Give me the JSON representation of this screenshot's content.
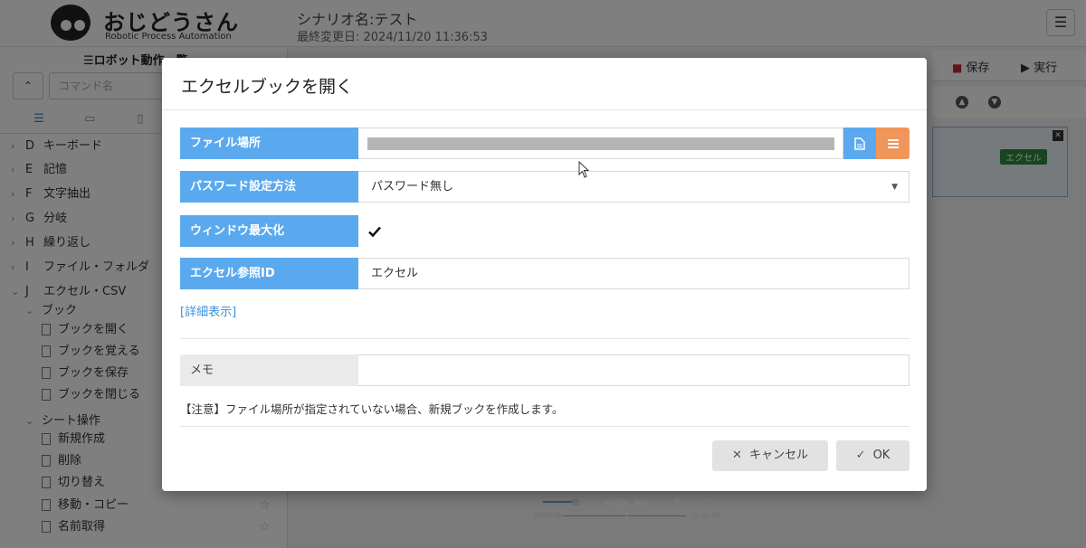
{
  "app": {
    "logo_title": "おじどうさん",
    "logo_subtitle": "Robotic Process Automation",
    "scenario_name": "シナリオ名:テスト",
    "last_modified": "最終変更日: 2024/11/20 11:36:53",
    "menu_icon": "hamburger-icon"
  },
  "left_panel": {
    "title": "☰ロボット動作一覧",
    "search_placeholder": "コマンド名",
    "tree": [
      {
        "letter": "D",
        "label": "キーボード"
      },
      {
        "letter": "E",
        "label": "記憶"
      },
      {
        "letter": "F",
        "label": "文字抽出"
      },
      {
        "letter": "G",
        "label": "分岐"
      },
      {
        "letter": "H",
        "label": "繰り返し"
      },
      {
        "letter": "I",
        "label": "ファイル・フォルダ"
      },
      {
        "letter": "J",
        "label": "エクセル・CSV"
      }
    ],
    "book_group": "ブック",
    "book_items": [
      "ブックを開く",
      "ブックを覚える",
      "ブックを保存",
      "ブックを閉じる"
    ],
    "sheet_group": "シート操作",
    "sheet_items": [
      "新規作成",
      "削除",
      "切り替え",
      "移動・コピー",
      "名前取得"
    ]
  },
  "right_panel": {
    "save_label": "保存",
    "run_label": "実行",
    "card_badge": "エクセル"
  },
  "video": {
    "time_current": "00:32:06",
    "time_total": "01:01:06"
  },
  "modal": {
    "title": "エクセルブックを開く",
    "fields": {
      "file_location": {
        "label": "ファイル場所",
        "value": ""
      },
      "password_method": {
        "label": "パスワード設定方法",
        "value": "パスワード無し"
      },
      "maximize_window": {
        "label": "ウィンドウ最大化",
        "checked": true
      },
      "excel_ref_id": {
        "label": "エクセル参照ID",
        "value": "エクセル"
      }
    },
    "detail_link": "[詳細表示]",
    "memo_label": "メモ",
    "memo_value": "",
    "note": "【注意】ファイル場所が指定されていない場合、新規ブックを作成します。",
    "cancel_label": "キャンセル",
    "ok_label": "OK"
  },
  "colors": {
    "label_blue": "#5aa9ef",
    "list_orange": "#f0965a",
    "link_blue": "#3d8fd8"
  }
}
